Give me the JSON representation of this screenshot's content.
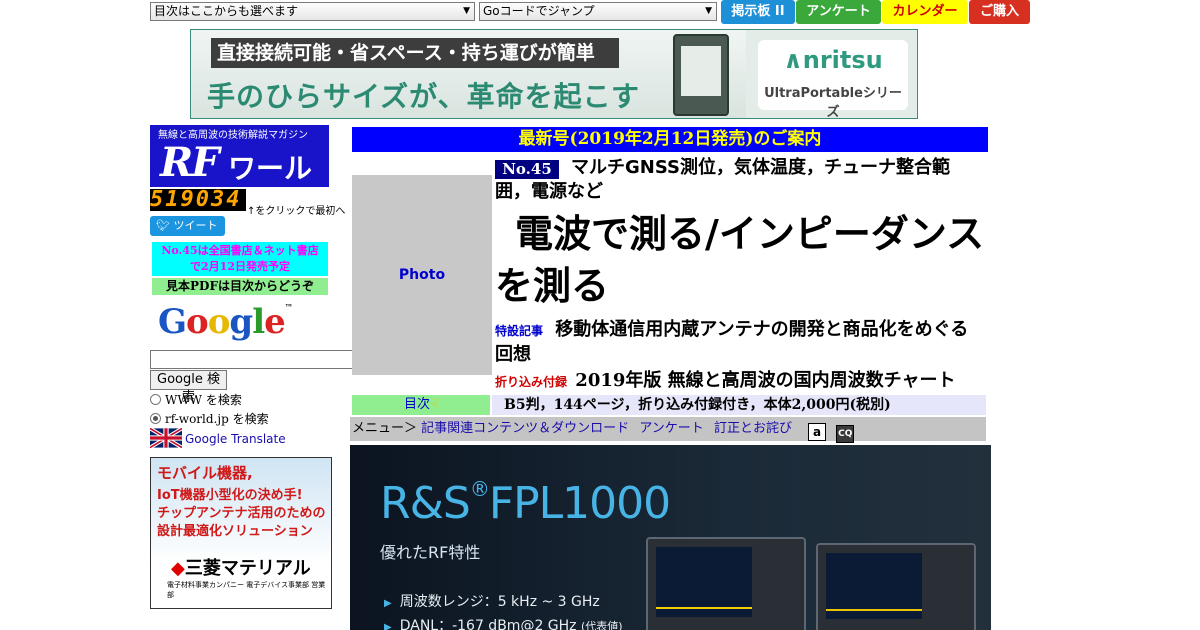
{
  "top": {
    "select_toc": "目次はここからも選べます",
    "select_gocode": "Goコードでジャンプ",
    "buttons": [
      {
        "label": "掲示板 II",
        "color": "#1e90d8"
      },
      {
        "label": "アンケート",
        "color": "#3aa83a"
      },
      {
        "label": "カレンダー",
        "color": "#ffff00"
      },
      {
        "label": "ご購入",
        "color": "#d83020"
      }
    ]
  },
  "ad1": {
    "line1": "直接接続可能・省スペース・持ち運びが簡単",
    "line2": "手のひらサイズが、革命を起こす",
    "brand": "∧nritsu",
    "brand_sub": "UltraPortableシリーズ"
  },
  "sidebar": {
    "logo_tagline": "無線と高周波の技術解説マガジン",
    "logo_rf": "RF",
    "logo_world": "ワールド",
    "counter": "519034",
    "counter_note": "↑をクリックで最初へ",
    "tweet": "ツイート",
    "notice_line1": "No.45は全国書店＆ネット書店",
    "notice_line2": "で2月12日発売予定",
    "pdf_note": "見本PDFは目次からどうぞ",
    "google_logo": "Google",
    "google_tm": "™",
    "search_button": "Google 検索",
    "radio_www": "WWW を検索",
    "radio_site": "rf-world.jp を検索",
    "translate": "Google Translate"
  },
  "ad2": {
    "line1": "モバイル機器,",
    "line2": "IoT機器小型化の決め手!",
    "line3": "チップアンテナ活用のための",
    "line4": "設計最適化ソリューション",
    "brand": "三菱マテリアル",
    "brand_mark": "◆",
    "small": "電子材料事業カンパニー 電子デバイス事業部 営業部"
  },
  "issue": {
    "header": "最新号(2019年2月12日発売)のご案内",
    "photo": "Photo",
    "number": "No.45",
    "subtitle": "マルチGNSS測位，気体温度，チューナ整合範囲，電源など",
    "title": "電波で測る/インピーダンスを測る",
    "feature_tag": "特設記事",
    "feature": "移動体通信用内蔵アンテナの開発と商品化をめぐる回想",
    "insert_tag": "折り込み付録",
    "insert": "2019年版 無線と高周波の国内周波数チャート",
    "toc": "目次",
    "specs": "B5判，144ページ，折り込み付録付き，本体2,000円(税別)"
  },
  "menu": {
    "label": "メニュー＞",
    "items": [
      "記事関連コンテンツ＆ダウンロード",
      "アンケート",
      "訂正とお詫び"
    ],
    "amazon_icon": "a",
    "other_icon": "CQ"
  },
  "ad3": {
    "title": "R&S",
    "reg": "®",
    "model": "FPL1000",
    "subtitle": "優れたRF特性",
    "line1": "周波数レンジ：5 kHz ~ 3 GHz",
    "line2": "DANL：-167 dBm@2 GHz",
    "line2_note": "(代表値)",
    "bullet": "▶"
  }
}
